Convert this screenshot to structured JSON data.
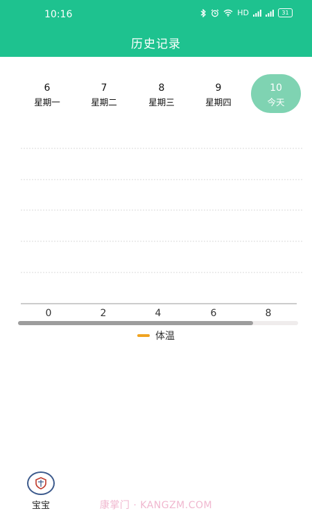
{
  "status_bar": {
    "time": "10:16",
    "network_label": "HD",
    "battery": "31"
  },
  "header": {
    "title": "历史记录"
  },
  "dates": [
    {
      "day": "6",
      "weekday": "星期一"
    },
    {
      "day": "7",
      "weekday": "星期二"
    },
    {
      "day": "8",
      "weekday": "星期三"
    },
    {
      "day": "9",
      "weekday": "星期四"
    },
    {
      "day": "10",
      "weekday": "今天",
      "selected": true
    }
  ],
  "chart_data": {
    "type": "line",
    "x_ticks": [
      "0",
      "2",
      "4",
      "6",
      "8"
    ],
    "series": [
      {
        "name": "体温",
        "values": []
      }
    ],
    "grid": true,
    "legend": "bottom",
    "scroll_position": 0.84
  },
  "legend": {
    "label": "体温"
  },
  "bottom": {
    "baby_label": "宝宝"
  },
  "watermark": "康掌门 · KANGZM.COM",
  "colors": {
    "accent": "#1ec28f",
    "today_bg": "#7fd3b2",
    "series_color": "#f0a320"
  }
}
